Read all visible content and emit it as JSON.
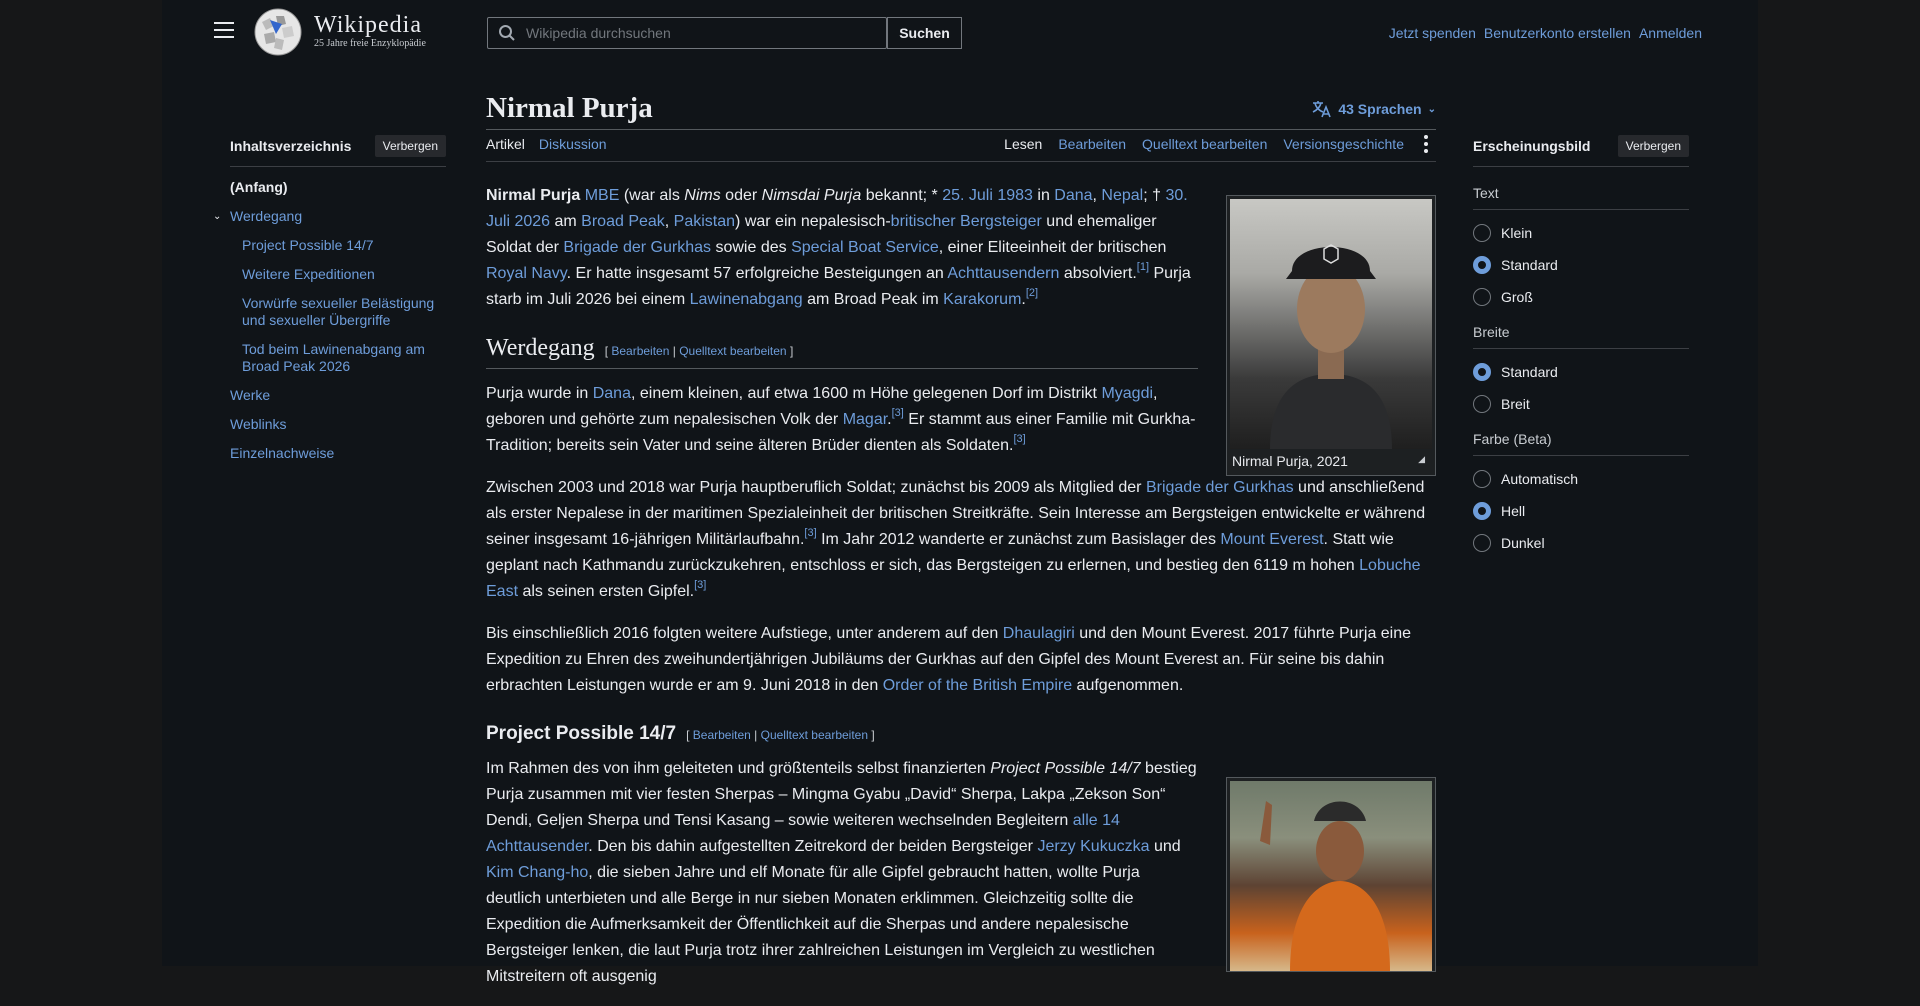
{
  "header": {
    "wordmark": "Wikipedia",
    "tagline": "25 Jahre freie Enzyklopädie",
    "search_placeholder": "Wikipedia durchsuchen",
    "search_button": "Suchen",
    "donate": "Jetzt spenden",
    "create_account": "Benutzerkonto erstellen",
    "login": "Anmelden"
  },
  "toc": {
    "title": "Inhaltsverzeichnis",
    "hide_button": "Verbergen",
    "items": [
      "(Anfang)",
      "Werdegang",
      "Project Possible 14/7",
      "Weitere Expeditionen",
      "Vorwürfe sexueller Belästigung und sexueller Übergriffe",
      "Tod beim Lawinenabgang am Broad Peak 2026",
      "Werke",
      "Weblinks",
      "Einzelnachweise"
    ]
  },
  "article": {
    "title": "Nirmal Purja",
    "languages": "43 Sprachen",
    "tabs": {
      "article": "Artikel",
      "discussion": "Diskussion",
      "read": "Lesen",
      "edit": "Bearbeiten",
      "edit_source": "Quelltext bearbeiten",
      "history": "Versionsgeschichte"
    },
    "intro": {
      "t0": "Nirmal Purja",
      "t1": " ",
      "l1": "MBE",
      "t2": " (war als ",
      "i1": "Nims",
      "t3": " oder ",
      "i2": "Nimsdai Purja",
      "t4": " bekannt; * ",
      "l2": "25. Juli 1983",
      "t5": " in ",
      "l3": "Dana",
      "t6": ", ",
      "l4": "Nepal",
      "t7": "; † ",
      "l5": "30. Juli 2026",
      "t8": " am ",
      "l6": "Broad Peak",
      "t9": ", ",
      "l7": "Pakistan",
      "t10": ") war ein nepalesisch-",
      "l8": "britischer Bergsteiger",
      "t11": " und ehemaliger Soldat der ",
      "l9": "Brigade der Gurkhas",
      "t12": " sowie des ",
      "l10": "Special Boat Service",
      "t13": ", einer Eliteeinheit der britischen ",
      "l11": "Royal Navy",
      "t14": ". Er hatte insgesamt 57 erfolgreiche Besteigungen an ",
      "l12": "Achttausendern",
      "t15": " absolviert.",
      "r1": "[1]",
      "t16": " Purja starb im Juli 2026 bei einem ",
      "l13": "Lawinenabgang",
      "t17": " am Broad Peak im ",
      "l14": "Karakorum",
      "t18": ".",
      "r2": "[2]"
    },
    "section_edit": {
      "open": "[ ",
      "edit": "Bearbeiten",
      "sep": " | ",
      "source": "Quelltext bearbeiten",
      "close": " ]"
    },
    "h_werdegang": "Werdegang",
    "p1": {
      "t1": "Purja wurde in ",
      "l1": "Dana",
      "t2": ", einem kleinen, auf etwa 1600 m Höhe gelegenen Dorf im Distrikt ",
      "l2": "Myagdi",
      "t3": ", geboren und gehörte zum nepalesischen Volk der ",
      "l3": "Magar",
      "t4": ".",
      "r1": "[3]",
      "t5": " Er stammt aus einer Familie mit Gurkha-Tradition; bereits sein Vater und seine älteren Brüder dienten als Soldaten.",
      "r2": "[3]"
    },
    "p2": {
      "t1": "Zwischen 2003 und 2018 war Purja hauptberuflich Soldat; zunächst bis 2009 als Mitglied der ",
      "l1": "Brigade der Gurkhas",
      "t2": " und anschließend als erster Nepalese in der maritimen Spezialeinheit der britischen Streitkräfte. Sein Interesse am Bergsteigen entwickelte er während seiner insgesamt 16-jährigen Militärlaufbahn.",
      "r1": "[3]",
      "t3": " Im Jahr 2012 wanderte er zunächst zum Basislager des ",
      "l2": "Mount Everest",
      "t4": ". Statt wie geplant nach Kathmandu zurückzukehren, entschloss er sich, das Bergsteigen zu erlernen, und bestieg den 6119 m hohen ",
      "l3": "Lobuche East",
      "t5": " als seinen ersten Gipfel.",
      "r2": "[3]"
    },
    "p3": {
      "t1": "Bis einschließlich 2016 folgten weitere Aufstiege, unter anderem auf den ",
      "l1": "Dhaulagiri",
      "t2": " und den Mount Everest. 2017 führte Purja eine Expedition zu Ehren des zweihundertjährigen Jubiläums der Gurkhas auf den Gipfel des Mount Everest an. Für seine bis dahin erbrachten Leistungen wurde er am 9. Juni 2018 in den ",
      "l2": "Order of the British Empire",
      "t3": " aufgenommen."
    },
    "h_project": "Project Possible 14/7",
    "p4": {
      "t1": "Im Rahmen des von ihm geleiteten und größtenteils selbst finanzierten ",
      "i1": "Project Possible 14/7",
      "t2": " bestieg Purja zusammen mit vier festen Sherpas – Mingma Gyabu „David“ Sherpa, Lakpa „Zekson Son“ Dendi, Geljen Sherpa und Tensi Kasang – sowie weiteren wechselnden Begleitern ",
      "l1": "alle 14 Achttausender",
      "t3": ". Den bis dahin aufgestellten Zeitrekord der beiden Bergsteiger ",
      "l2": "Jerzy Kukuczka",
      "t4": " und ",
      "l3": "Kim Chang-ho",
      "t5": ", die sieben Jahre und elf Monate für alle Gipfel gebraucht hatten, wollte Purja deutlich unterbieten und alle Berge in nur sieben Monaten erklimmen. Gleichzeitig sollte die Expedition die Aufmerksamkeit der Öffentlichkeit auf die Sherpas und andere nepalesische Bergsteiger lenken, die laut Purja trotz ihrer zahlreichen Leistungen im Vergleich zu westlichen Mitstreitern oft ausgenig"
    },
    "infobox_caption": "Nirmal Purja, 2021"
  },
  "appearance": {
    "title": "Erscheinungsbild",
    "hide_button": "Verbergen",
    "text_label": "Text",
    "text_options": [
      "Klein",
      "Standard",
      "Groß"
    ],
    "text_selected": "Standard",
    "width_label": "Breite",
    "width_options": [
      "Standard",
      "Breit"
    ],
    "width_selected": "Standard",
    "color_label": "Farbe (Beta)",
    "color_options": [
      "Automatisch",
      "Hell",
      "Dunkel"
    ],
    "color_selected": "Hell"
  },
  "colors": {
    "link": "#6e9dda",
    "text": "#eaecf0",
    "background": "#101418",
    "outside": "#161718"
  },
  "icons": [
    "menu-icon",
    "wikipedia-globe-icon",
    "search-icon",
    "translate-icon",
    "chevron-down-icon",
    "kebab-icon",
    "expand-icon"
  ]
}
